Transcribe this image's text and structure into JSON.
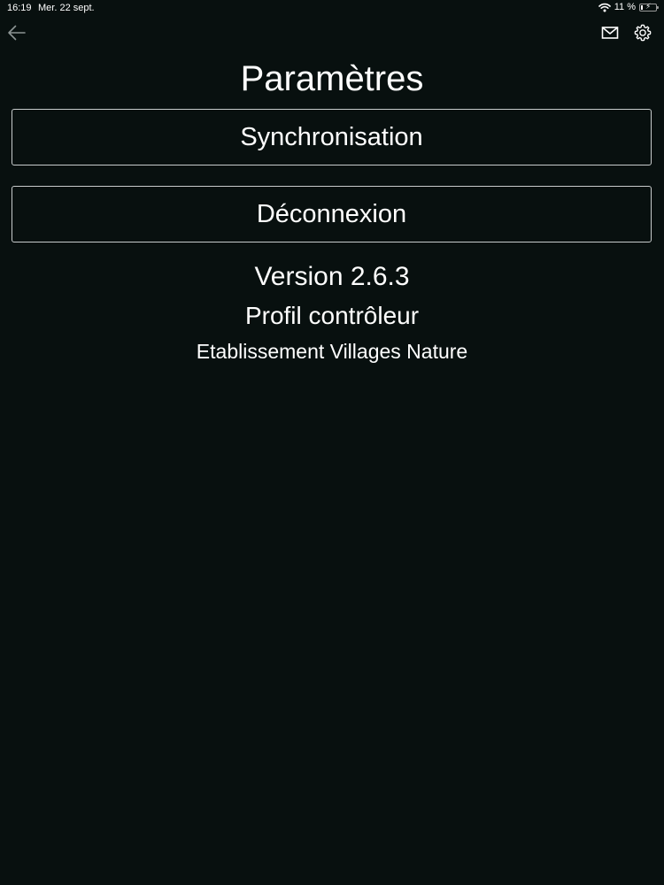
{
  "status_bar": {
    "time": "16:19",
    "date": "Mer. 22 sept.",
    "battery_text": "11 %",
    "battery_level": 0.11
  },
  "nav": {
    "back_icon": "arrow-left-icon",
    "mail_icon": "mail-icon",
    "settings_icon": "gear-icon"
  },
  "page": {
    "title": "Paramètres"
  },
  "buttons": {
    "sync_label": "Synchronisation",
    "logout_label": "Déconnexion"
  },
  "info": {
    "version": "Version 2.6.3",
    "profile": "Profil contrôleur",
    "establishment": "Etablissement Villages Nature"
  },
  "colors": {
    "background": "#08100f",
    "text": "#ffffff",
    "button_border": "#c8cccc",
    "back_icon": "#8c9494"
  }
}
